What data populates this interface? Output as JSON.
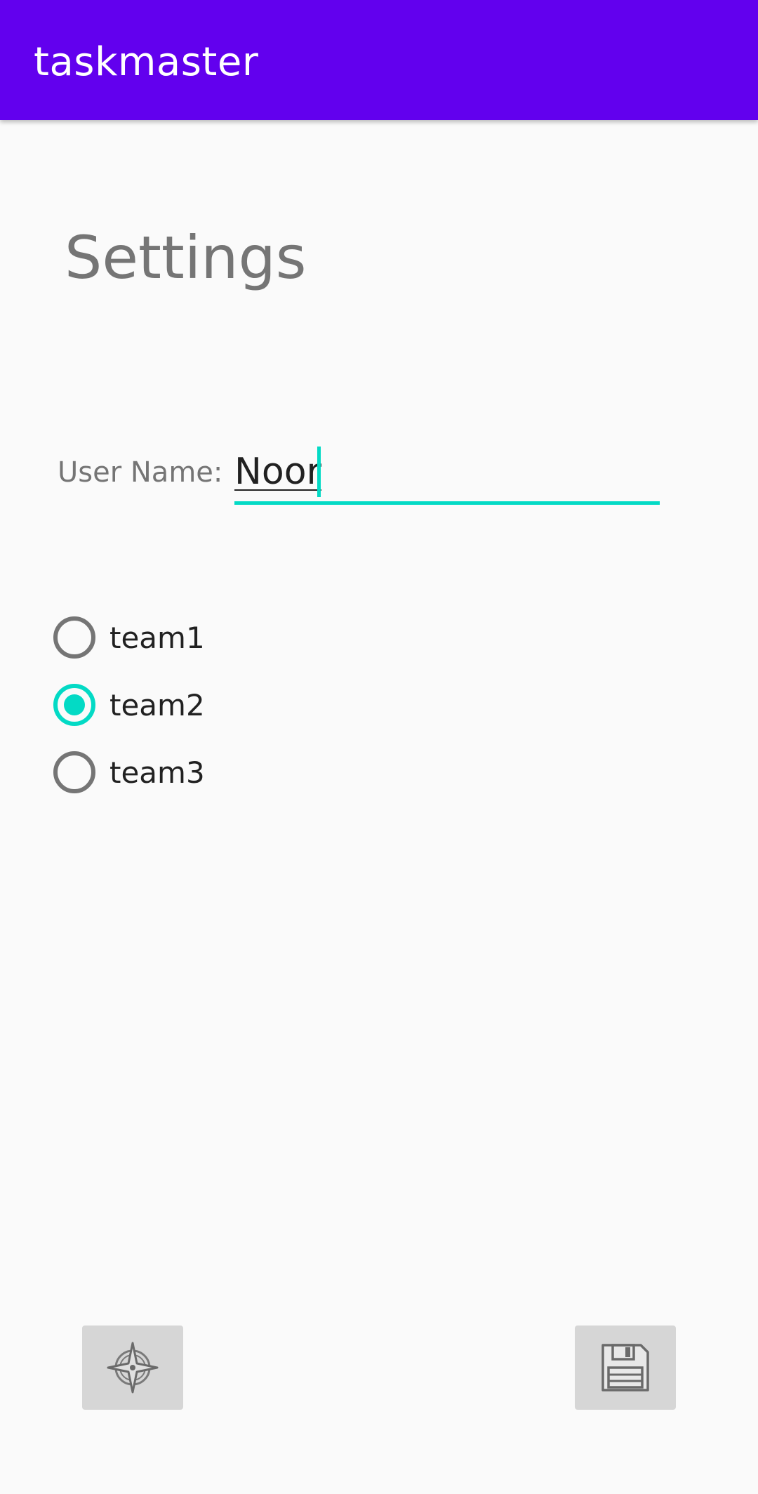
{
  "app_bar": {
    "title": "taskmaster",
    "background_color": "#6200ee"
  },
  "page": {
    "heading": "Settings"
  },
  "username": {
    "label": "User Name:",
    "value": "Noor",
    "accent_color": "#03dac5"
  },
  "teams": {
    "options": [
      {
        "label": "team1",
        "selected": false
      },
      {
        "label": "team2",
        "selected": true
      },
      {
        "label": "team3",
        "selected": false
      }
    ]
  },
  "bottom_buttons": {
    "left_icon": "compass-icon",
    "right_icon": "save-icon"
  }
}
